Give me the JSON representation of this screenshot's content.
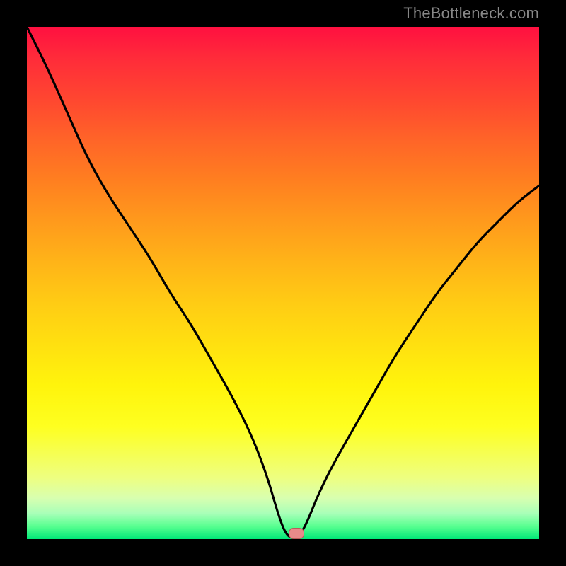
{
  "watermark": "TheBottleneck.com",
  "marker": {
    "x_norm": 0.525,
    "y_norm": 0.99,
    "color": "#e98a8a"
  },
  "chart_data": {
    "type": "line",
    "title": "",
    "xlabel": "",
    "ylabel": "",
    "xlim": [
      0,
      1
    ],
    "ylim": [
      0,
      1
    ],
    "background": "vertical-gradient red→orange→yellow→green",
    "series": [
      {
        "name": "bottleneck-curve",
        "x": [
          0.0,
          0.04,
          0.08,
          0.12,
          0.16,
          0.2,
          0.24,
          0.28,
          0.32,
          0.36,
          0.4,
          0.44,
          0.47,
          0.49,
          0.505,
          0.52,
          0.535,
          0.55,
          0.57,
          0.6,
          0.64,
          0.68,
          0.72,
          0.76,
          0.8,
          0.84,
          0.88,
          0.92,
          0.96,
          1.0
        ],
        "y": [
          1.0,
          0.92,
          0.83,
          0.74,
          0.67,
          0.61,
          0.55,
          0.48,
          0.42,
          0.35,
          0.28,
          0.2,
          0.12,
          0.05,
          0.01,
          0.0,
          0.01,
          0.04,
          0.09,
          0.15,
          0.22,
          0.29,
          0.36,
          0.42,
          0.48,
          0.53,
          0.58,
          0.62,
          0.66,
          0.69
        ]
      }
    ],
    "annotations": [
      {
        "type": "point-marker",
        "x": 0.525,
        "y": 0.0,
        "color": "#e98a8a",
        "shape": "rounded-pill"
      }
    ]
  }
}
